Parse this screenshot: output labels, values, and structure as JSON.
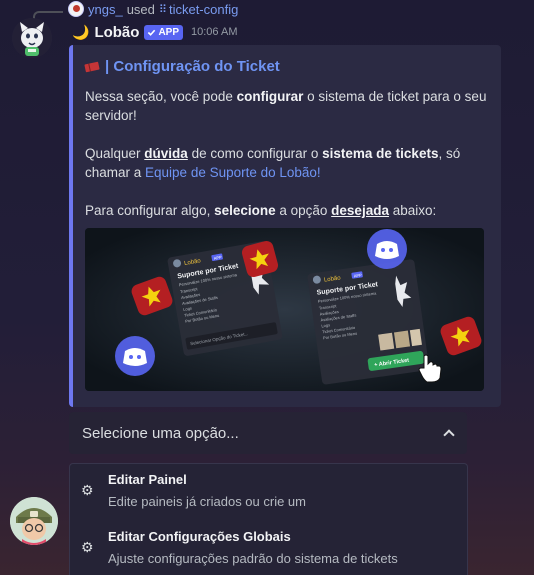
{
  "reply": {
    "username": "yngs_",
    "used_text": "used",
    "command": "ticket-config"
  },
  "message": {
    "author": "Lobão",
    "author_emoji": "🌙",
    "app_badge": "APP",
    "timestamp": "10:06 AM"
  },
  "embed": {
    "accent_color": "#6e78f0",
    "title": "| Configuração do Ticket",
    "p1": {
      "a": "Nessa seção, você pode ",
      "b": "configurar",
      "c": " o sistema de ticket para o seu servidor!"
    },
    "p2": {
      "a": "Qualquer ",
      "b": "dúvida",
      "c": " de como configurar o ",
      "d": "sistema de tickets",
      "e": ", só chamar a ",
      "link": "Equipe de Suporte do Lobão!"
    },
    "p3": {
      "a": "Para configurar algo, ",
      "b": "selecione",
      "c": " a opção ",
      "d": "desejada",
      "e": " abaixo:"
    },
    "image": {
      "left_card": {
        "author": "Lobão",
        "badge": "APP",
        "title": "Suporte por Ticket",
        "subtitle": "Personalize 100% nosso sistema",
        "items": [
          "Transcript",
          "Avaliações",
          "Avaliações de Staffs",
          "Logs",
          "Ticket Comunitário",
          "Por Botão ou Menu"
        ],
        "select_placeholder": "Selecionar Opção do Ticket..."
      },
      "right_card": {
        "author": "Lobão",
        "badge": "APP",
        "title": "Suporte por Ticket",
        "subtitle": "Personalize 100% nosso sistema",
        "items": [
          "Transcript",
          "Avaliações",
          "Avaliações de Staffs",
          "Logs",
          "Ticket Comunitário",
          "Por Botão ou Menu"
        ],
        "button": "+ Abrir Ticket"
      }
    }
  },
  "select_menu": {
    "placeholder": "Selecione uma opção...",
    "options": [
      {
        "title": "Editar Painel",
        "description": "Edite paineis já criados ou crie um",
        "icon": "gear-icon"
      },
      {
        "title": "Editar Configurações Globais",
        "description": "Ajuste configurações padrão do sistema de tickets",
        "icon": "gear-icon"
      }
    ]
  },
  "colors": {
    "link": "#6f94f3",
    "app_badge": "#5865f2",
    "button_green": "#2fa55a",
    "ticket_red": "#c53537"
  }
}
